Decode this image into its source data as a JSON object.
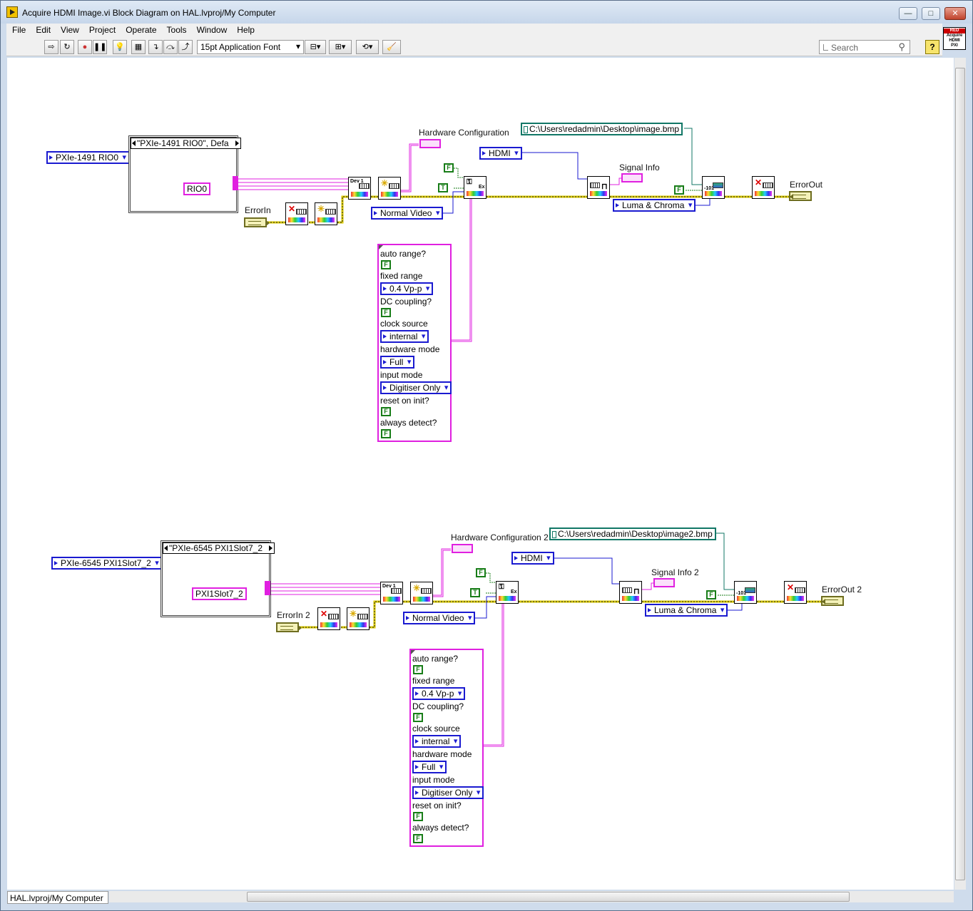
{
  "window": {
    "title": "Acquire HDMI Image.vi Block Diagram on HAL.lvproj/My Computer",
    "min": "—",
    "max": "□",
    "close": "✕"
  },
  "menu": [
    "File",
    "Edit",
    "View",
    "Project",
    "Operate",
    "Tools",
    "Window",
    "Help"
  ],
  "toolbar": {
    "font": "15pt Application Font",
    "search_placeholder": "Search",
    "help": "?"
  },
  "vi_icon": {
    "line1": "RED",
    "line2": "Acquire",
    "line3": "HDMI",
    "line4": "PXI"
  },
  "status": {
    "context": "HAL.lvproj/My Computer"
  },
  "diagram": {
    "chains": [
      {
        "resource": "PXIe-1491 RIO0",
        "case_selector": "\"PXIe-1491 RIO0\", Defa",
        "alias": "RIO0",
        "error_in": "ErrorIn",
        "error_out": "ErrorOut",
        "hw_config": "Hardware Configuration",
        "signal_info": "Signal Info",
        "source": "HDMI",
        "video_mode": "Normal Video",
        "color_mode": "Luma & Chroma",
        "path": "C:\\Users\\redadmin\\Desktop\\image.bmp",
        "config": {
          "auto_range": "auto range?",
          "fixed_range": "fixed range",
          "fixed_range_val": "0.4 Vp-p",
          "dc_coupling": "DC coupling?",
          "clock_source": "clock source",
          "clock_source_val": "internal",
          "hardware_mode": "hardware mode",
          "hardware_mode_val": "Full",
          "input_mode": "input mode",
          "input_mode_val": "Digitiser Only",
          "reset_on_init": "reset on init?",
          "always_detect": "always detect?"
        }
      },
      {
        "resource": "PXIe-6545 PXI1Slot7_2",
        "case_selector": "\"PXIe-6545 PXI1Slot7_2",
        "alias": "PXI1Slot7_2",
        "error_in": "ErrorIn 2",
        "error_out": "ErrorOut 2",
        "hw_config": "Hardware Configuration 2",
        "signal_info": "Signal Info 2",
        "source": "HDMI",
        "video_mode": "Normal Video",
        "color_mode": "Luma & Chroma",
        "path": "C:\\Users\\redadmin\\Desktop\\image2.bmp",
        "config": {
          "auto_range": "auto range?",
          "fixed_range": "fixed range",
          "fixed_range_val": "0.4 Vp-p",
          "dc_coupling": "DC coupling?",
          "clock_source": "clock source",
          "clock_source_val": "internal",
          "hardware_mode": "hardware mode",
          "hardware_mode_val": "Full",
          "input_mode": "input mode",
          "input_mode_val": "Digitiser Only",
          "reset_on_init": "reset on init?",
          "always_detect": "always detect?"
        }
      }
    ],
    "bool_false": "F",
    "bool_true": "T",
    "dev_label": "Dev 1",
    "ex_label": "Ex",
    "colors": {
      "error_wire": "#d8c800",
      "cluster_wire": "#e020e0",
      "enum_wire": "#1a1ad0",
      "bool_wire": "#187d18",
      "path_wire": "#117766"
    }
  }
}
